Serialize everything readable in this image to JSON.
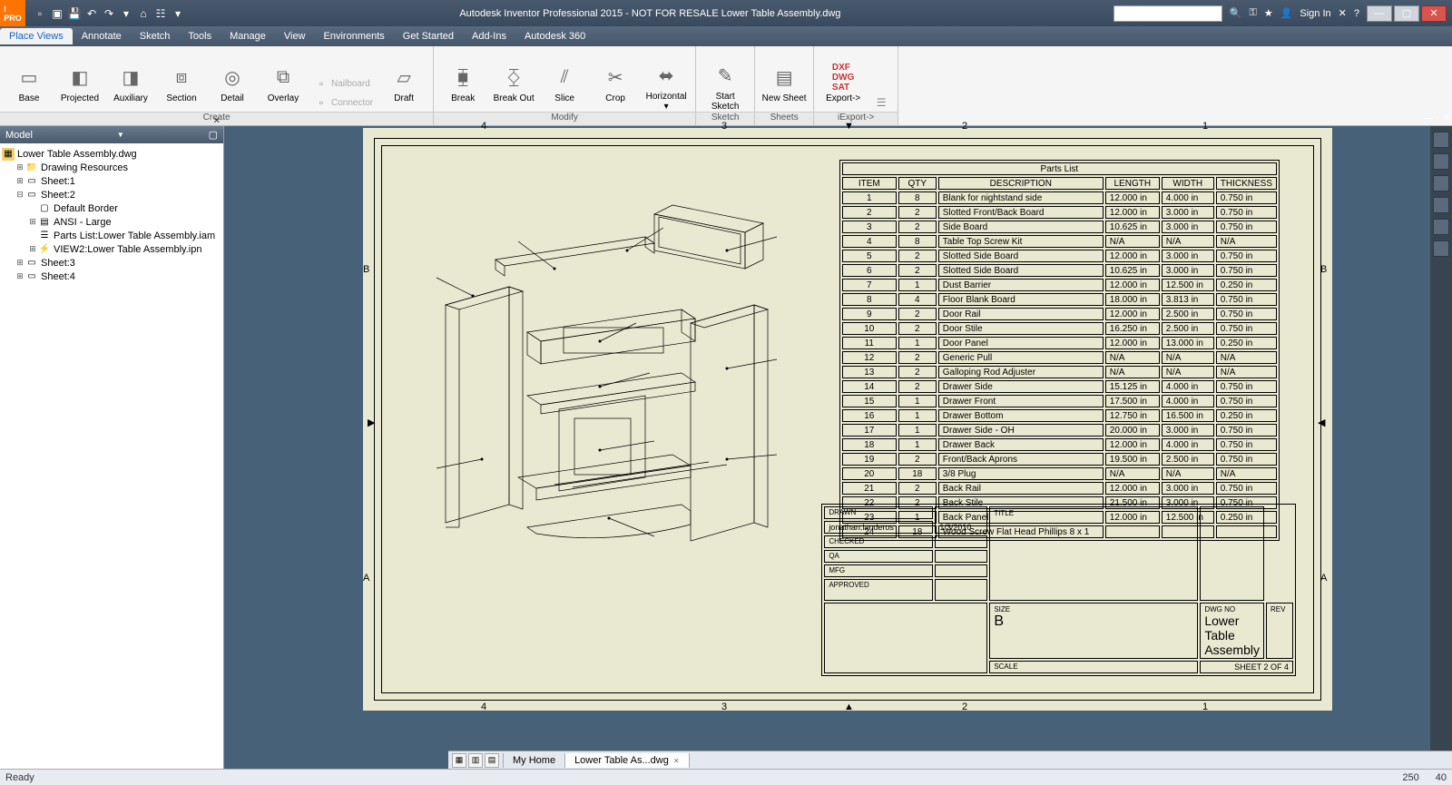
{
  "app_title": "Autodesk Inventor Professional 2015 - NOT FOR RESALE     Lower Table Assembly.dwg",
  "signin": "Sign In",
  "menu_tabs": [
    "Place Views",
    "Annotate",
    "Sketch",
    "Tools",
    "Manage",
    "View",
    "Environments",
    "Get Started",
    "Add-Ins",
    "Autodesk 360"
  ],
  "menu_active": 0,
  "ribbon": {
    "create": {
      "label": "Create",
      "btns": [
        "Base",
        "Projected",
        "Auxiliary",
        "Section",
        "Detail",
        "Overlay"
      ],
      "small": [
        {
          "label": "Nailboard",
          "disabled": true
        },
        {
          "label": "Connector",
          "disabled": true
        }
      ],
      "draft": "Draft"
    },
    "modify": {
      "label": "Modify",
      "btns": [
        "Break",
        "Break Out",
        "Slice",
        "Crop"
      ],
      "horiz": "Horizontal"
    },
    "sketch": {
      "label": "Sketch",
      "btn": "Start\nSketch"
    },
    "sheets": {
      "label": "Sheets",
      "btn": "New Sheet"
    },
    "iexport": {
      "label": "iExport->",
      "btn": "Export->"
    }
  },
  "browser": {
    "title": "Model",
    "root": "Lower Table Assembly.dwg",
    "items": [
      {
        "label": "Drawing Resources",
        "type": "folder",
        "indent": 1,
        "tw": "+"
      },
      {
        "label": "Sheet:1",
        "type": "sheet",
        "indent": 1,
        "tw": "+"
      },
      {
        "label": "Sheet:2",
        "type": "sheet",
        "indent": 1,
        "tw": "-"
      },
      {
        "label": "Default Border",
        "type": "border",
        "indent": 2,
        "tw": ""
      },
      {
        "label": "ANSI - Large",
        "type": "title",
        "indent": 2,
        "tw": "+"
      },
      {
        "label": "Parts List:Lower Table Assembly.iam",
        "type": "pl",
        "indent": 2,
        "tw": ""
      },
      {
        "label": "VIEW2:Lower Table Assembly.ipn",
        "type": "view",
        "indent": 2,
        "tw": "+"
      },
      {
        "label": "Sheet:3",
        "type": "sheet",
        "indent": 1,
        "tw": "+"
      },
      {
        "label": "Sheet:4",
        "type": "sheet",
        "indent": 1,
        "tw": "+"
      }
    ]
  },
  "parts_list_title": "Parts List",
  "parts_headers": [
    "ITEM",
    "QTY",
    "DESCRIPTION",
    "LENGTH",
    "WIDTH",
    "THICKNESS"
  ],
  "parts": [
    [
      "1",
      "8",
      "Blank for nightstand side",
      "12.000 in",
      "4.000 in",
      "0.750 in"
    ],
    [
      "2",
      "2",
      "Slotted Front/Back Board",
      "12.000 in",
      "3.000 in",
      "0.750 in"
    ],
    [
      "3",
      "2",
      "Side Board",
      "10.625 in",
      "3.000 in",
      "0.750 in"
    ],
    [
      "4",
      "8",
      "Table Top Screw Kit",
      "N/A",
      "N/A",
      "N/A"
    ],
    [
      "5",
      "2",
      "Slotted Side Board",
      "12.000 in",
      "3.000 in",
      "0.750 in"
    ],
    [
      "6",
      "2",
      "Slotted Side Board",
      "10.625 in",
      "3.000 in",
      "0.750 in"
    ],
    [
      "7",
      "1",
      "Dust Barrier",
      "12.000 in",
      "12.500 in",
      "0.250 in"
    ],
    [
      "8",
      "4",
      "Floor Blank Board",
      "18.000 in",
      "3.813 in",
      "0.750 in"
    ],
    [
      "9",
      "2",
      "Door Rail",
      "12.000 in",
      "2.500 in",
      "0.750 in"
    ],
    [
      "10",
      "2",
      "Door Stile",
      "16.250 in",
      "2.500 in",
      "0.750 in"
    ],
    [
      "11",
      "1",
      "Door Panel",
      "12.000 in",
      "13.000 in",
      "0.250 in"
    ],
    [
      "12",
      "2",
      "Generic Pull",
      "N/A",
      "N/A",
      "N/A"
    ],
    [
      "13",
      "2",
      "Galloping Rod Adjuster",
      "N/A",
      "N/A",
      "N/A"
    ],
    [
      "14",
      "2",
      "Drawer Side",
      "15.125 in",
      "4.000 in",
      "0.750 in"
    ],
    [
      "15",
      "1",
      "Drawer Front",
      "17.500 in",
      "4.000 in",
      "0.750 in"
    ],
    [
      "16",
      "1",
      "Drawer Bottom",
      "12.750 in",
      "16.500 in",
      "0.250 in"
    ],
    [
      "17",
      "1",
      "Drawer Side - OH",
      "20.000 in",
      "3.000 in",
      "0.750 in"
    ],
    [
      "18",
      "1",
      "Drawer Back",
      "12.000 in",
      "4.000 in",
      "0.750 in"
    ],
    [
      "19",
      "2",
      "Front/Back Aprons",
      "19.500 in",
      "2.500 in",
      "0.750 in"
    ],
    [
      "20",
      "18",
      "3/8 Plug",
      "N/A",
      "N/A",
      "N/A"
    ],
    [
      "21",
      "2",
      "Back Rail",
      "12.000 in",
      "3.000 in",
      "0.750 in"
    ],
    [
      "22",
      "2",
      "Back Stile",
      "21.500 in",
      "3.000 in",
      "0.750 in"
    ],
    [
      "23",
      "1",
      "Back Panel",
      "12.000 in",
      "12.500 in",
      "0.250 in"
    ],
    [
      "24",
      "18",
      "Wood Screw Flat Head Phillips 8 x 1",
      "",
      "",
      ""
    ]
  ],
  "title_block": {
    "drawn_lbl": "DRAWN",
    "drawn_by": "jonathan.landeros",
    "drawn_date": "1/3/2010",
    "checked_lbl": "CHECKED",
    "qa_lbl": "QA",
    "mfg_lbl": "MFG",
    "approved_lbl": "APPROVED",
    "title_lbl": "TITLE",
    "size_lbl": "SIZE",
    "size": "B",
    "dwgno_lbl": "DWG NO",
    "rev_lbl": "REV",
    "dwgname": "Lower Table Assembly",
    "scale_lbl": "SCALE",
    "sheet": "SHEET 2  OF  4"
  },
  "zones": {
    "top": [
      "4",
      "3",
      "2",
      "1"
    ],
    "left": [
      "B",
      "A"
    ]
  },
  "doc_tabs": [
    {
      "label": "My Home"
    },
    {
      "label": "Lower Table As...dwg",
      "active": true,
      "closable": true
    }
  ],
  "status": {
    "left": "Ready",
    "right": [
      "250",
      "40"
    ]
  }
}
